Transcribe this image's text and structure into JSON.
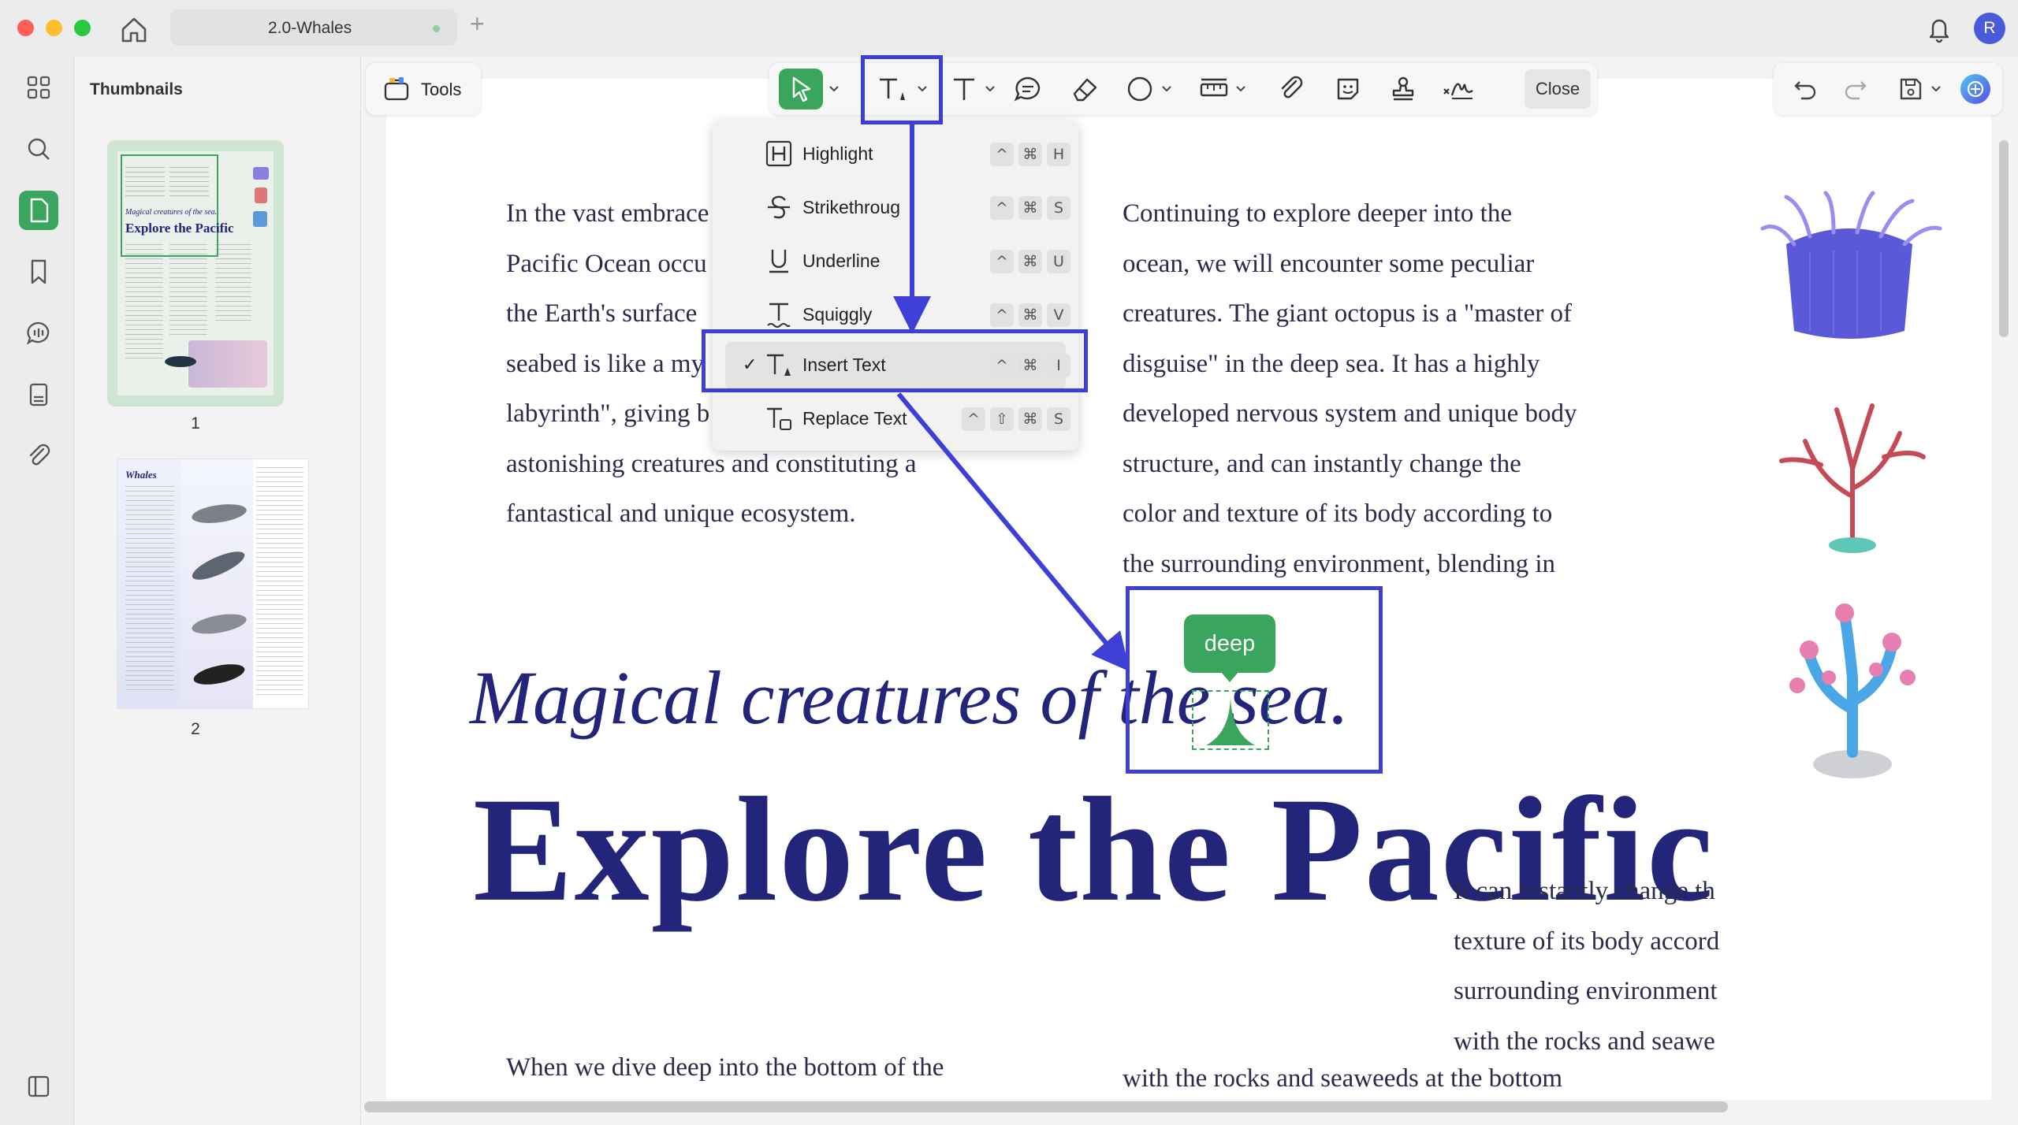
{
  "window": {
    "tab_title": "2.0-Whales",
    "avatar_initial": "R"
  },
  "sidebar": {
    "title": "Thumbnails",
    "thumbnails": [
      {
        "page_number": "1",
        "mini_italic": "Magical creatures of the sea.",
        "mini_title": "Explore the Pacific"
      },
      {
        "page_number": "2",
        "mini_title": "Whales"
      }
    ]
  },
  "toolbar": {
    "tools_label": "Tools",
    "close_label": "Close"
  },
  "text_markup_menu": {
    "items": [
      {
        "label": "Highlight",
        "keys": [
          "^",
          "⌘",
          "H"
        ],
        "selected": false
      },
      {
        "label": "Strikethroug",
        "keys": [
          "^",
          "⌘",
          "S"
        ],
        "selected": false
      },
      {
        "label": "Underline",
        "keys": [
          "^",
          "⌘",
          "U"
        ],
        "selected": false
      },
      {
        "label": "Squiggly",
        "keys": [
          "^",
          "⌘",
          "V"
        ],
        "selected": false
      },
      {
        "label": "Insert Text",
        "keys": [
          "^",
          "⌘",
          "I"
        ],
        "selected": true
      },
      {
        "label": "Replace Text",
        "keys": [
          "^",
          "⇧",
          "⌘",
          "S"
        ],
        "selected": false
      }
    ],
    "check_mark": "✓"
  },
  "document": {
    "col1_lines": [
      "In the vast embrace",
      "Pacific Ocean occu",
      "the Earth's surface",
      "seabed is like a my",
      "labyrinth\", giving b",
      "astonishing creatures and constituting a",
      "fantastical and unique ecosystem."
    ],
    "col2_lines": [
      "Continuing to explore deeper into the",
      "ocean, we will encounter some peculiar",
      "creatures. The giant octopus is a \"master of",
      "disguise\" in the deep sea. It has a highly",
      "developed nervous system and unique body",
      "structure, and can instantly change the",
      "color and texture of its body according to",
      "the surrounding environment, blending in"
    ],
    "subtitle": "Magical creatures of the sea.",
    "title": "Explore the Pacific",
    "col1_bottom": "When we dive deep into the bottom of the",
    "col2_bottom": "with the rocks and seaweeds at the bottom",
    "col3_lines": [
      "It can instantly change th",
      "texture of its body accord",
      "surrounding environment",
      "with the rocks and seawe"
    ]
  },
  "insert_text_bubble": {
    "text": "deep"
  },
  "colors": {
    "accent_green": "#3aa55d",
    "heading_navy": "#23257a",
    "highlight_box": "#3d3fd6"
  }
}
